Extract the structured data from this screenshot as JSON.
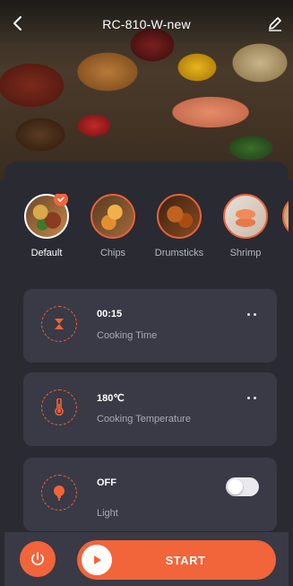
{
  "header": {
    "title": "RC-810-W-new",
    "back_icon": "chevron-left-icon",
    "edit_icon": "pencil-icon"
  },
  "presets": [
    {
      "label": "Default",
      "selected": true
    },
    {
      "label": "Chips",
      "selected": false
    },
    {
      "label": "Drumsticks",
      "selected": false
    },
    {
      "label": "Shrimp",
      "selected": false
    },
    {
      "label": "",
      "selected": false
    }
  ],
  "settings": {
    "time": {
      "value": "00:15",
      "label": "Cooking Time",
      "icon": "hourglass-icon"
    },
    "temperature": {
      "value": "180℃",
      "label": "Cooking Temperature",
      "icon": "thermometer-icon"
    },
    "light": {
      "value": "OFF",
      "label": "Light",
      "icon": "lightbulb-icon",
      "on": false
    }
  },
  "actions": {
    "start_label": "START",
    "power_icon": "power-icon",
    "play_icon": "play-icon"
  },
  "colors": {
    "accent": "#f2643a",
    "panel": "#2a2a33",
    "card": "#393a45"
  }
}
